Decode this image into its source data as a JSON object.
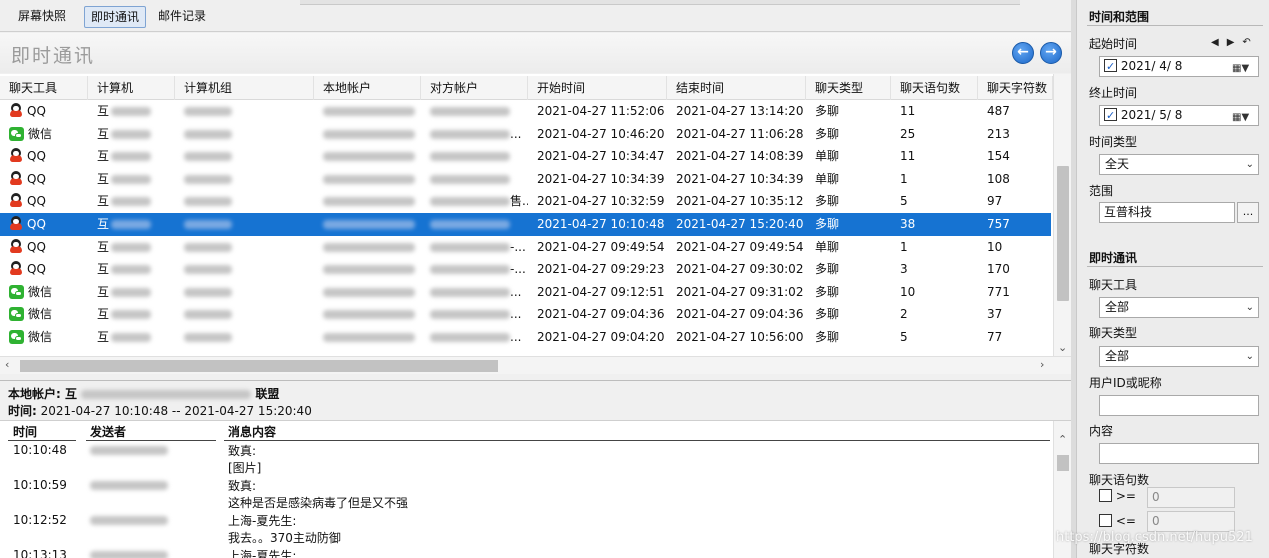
{
  "tabs": [
    {
      "label": "屏幕快照",
      "active": false
    },
    {
      "label": "即时通讯",
      "active": true
    },
    {
      "label": "邮件记录",
      "active": false
    }
  ],
  "section_title": "即时通讯",
  "nav": {
    "prev_icon": "arrow-left-circle-icon",
    "next_icon": "arrow-right-circle-icon"
  },
  "table": {
    "columns": [
      "聊天工具",
      "计算机",
      "计算机组",
      "本地帐户",
      "对方帐户",
      "开始时间",
      "结束时间",
      "聊天类型",
      "聊天语句数",
      "聊天字符数"
    ],
    "rows": [
      {
        "tool": "QQ",
        "computer": "互",
        "other_suffix": "",
        "start": "2021-04-27 11:52:06",
        "end": "2021-04-27 13:14:20",
        "type": "多聊",
        "sentences": "11",
        "chars": "487"
      },
      {
        "tool": "微信",
        "computer": "互",
        "other_suffix": "...",
        "start": "2021-04-27 10:46:20",
        "end": "2021-04-27 11:06:28",
        "type": "多聊",
        "sentences": "25",
        "chars": "213"
      },
      {
        "tool": "QQ",
        "computer": "互",
        "other_suffix": "",
        "start": "2021-04-27 10:34:47",
        "end": "2021-04-27 14:08:39",
        "type": "单聊",
        "sentences": "11",
        "chars": "154"
      },
      {
        "tool": "QQ",
        "computer": "互",
        "other_suffix": "",
        "start": "2021-04-27 10:34:39",
        "end": "2021-04-27 10:34:39",
        "type": "单聊",
        "sentences": "1",
        "chars": "108"
      },
      {
        "tool": "QQ",
        "computer": "互",
        "other_suffix": "售...",
        "start": "2021-04-27 10:32:59",
        "end": "2021-04-27 10:35:12",
        "type": "多聊",
        "sentences": "5",
        "chars": "97"
      },
      {
        "tool": "QQ",
        "computer": "互",
        "other_suffix": "",
        "start": "2021-04-27 10:10:48",
        "end": "2021-04-27 15:20:40",
        "type": "多聊",
        "sentences": "38",
        "chars": "757",
        "selected": true
      },
      {
        "tool": "QQ",
        "computer": "互",
        "other_suffix": "-...",
        "start": "2021-04-27 09:49:54",
        "end": "2021-04-27 09:49:54",
        "type": "单聊",
        "sentences": "1",
        "chars": "10"
      },
      {
        "tool": "QQ",
        "computer": "互",
        "other_suffix": "-...",
        "start": "2021-04-27 09:29:23",
        "end": "2021-04-27 09:30:02",
        "type": "多聊",
        "sentences": "3",
        "chars": "170"
      },
      {
        "tool": "微信",
        "computer": "互",
        "other_suffix": "...",
        "start": "2021-04-27 09:12:51",
        "end": "2021-04-27 09:31:02",
        "type": "多聊",
        "sentences": "10",
        "chars": "771"
      },
      {
        "tool": "微信",
        "computer": "互",
        "other_suffix": "...",
        "start": "2021-04-27 09:04:36",
        "end": "2021-04-27 09:04:36",
        "type": "多聊",
        "sentences": "2",
        "chars": "37"
      },
      {
        "tool": "微信",
        "computer": "互",
        "other_suffix": "...",
        "start": "2021-04-27 09:04:20",
        "end": "2021-04-27 10:56:00",
        "type": "多聊",
        "sentences": "5",
        "chars": "77"
      }
    ]
  },
  "detail": {
    "account_label": "本地帐户:",
    "account_value_prefix": "互",
    "account_value_suffix": "联盟",
    "time_label": "时间:",
    "time_value": "2021-04-27 10:10:48 -- 2021-04-27 15:20:40",
    "columns": [
      "时间",
      "发送者",
      "消息内容"
    ],
    "messages": [
      {
        "time": "10:10:48",
        "lines": [
          "致真:",
          "[图片]"
        ]
      },
      {
        "time": "10:10:59",
        "lines": [
          "致真:",
          "这种是否是感染病毒了但是又不强"
        ]
      },
      {
        "time": "10:12:52",
        "lines": [
          "上海-夏先生:",
          "我去。。370主动防御"
        ]
      },
      {
        "time": "10:13:13",
        "lines": [
          "上海-夏先生:"
        ]
      }
    ]
  },
  "filters": {
    "time_section": "时间和范围",
    "start_label": "起始时间",
    "start_value": "2021/ 4/ 8",
    "end_label": "终止时间",
    "end_value": "2021/ 5/ 8",
    "time_type_label": "时间类型",
    "time_type_value": "全天",
    "scope_label": "范围",
    "scope_value": "互普科技",
    "scope_btn": "...",
    "im_section": "即时通讯",
    "tool_label": "聊天工具",
    "tool_value": "全部",
    "chat_type_label": "聊天类型",
    "chat_type_value": "全部",
    "userid_label": "用户ID或昵称",
    "content_label": "内容",
    "sentences_label": "聊天语句数",
    "ge": ">=",
    "le": "<=",
    "ge_value": "0",
    "le_value": "0",
    "chars_label": "聊天字符数"
  },
  "watermark": "https://blog.csdn.net/hupu521"
}
